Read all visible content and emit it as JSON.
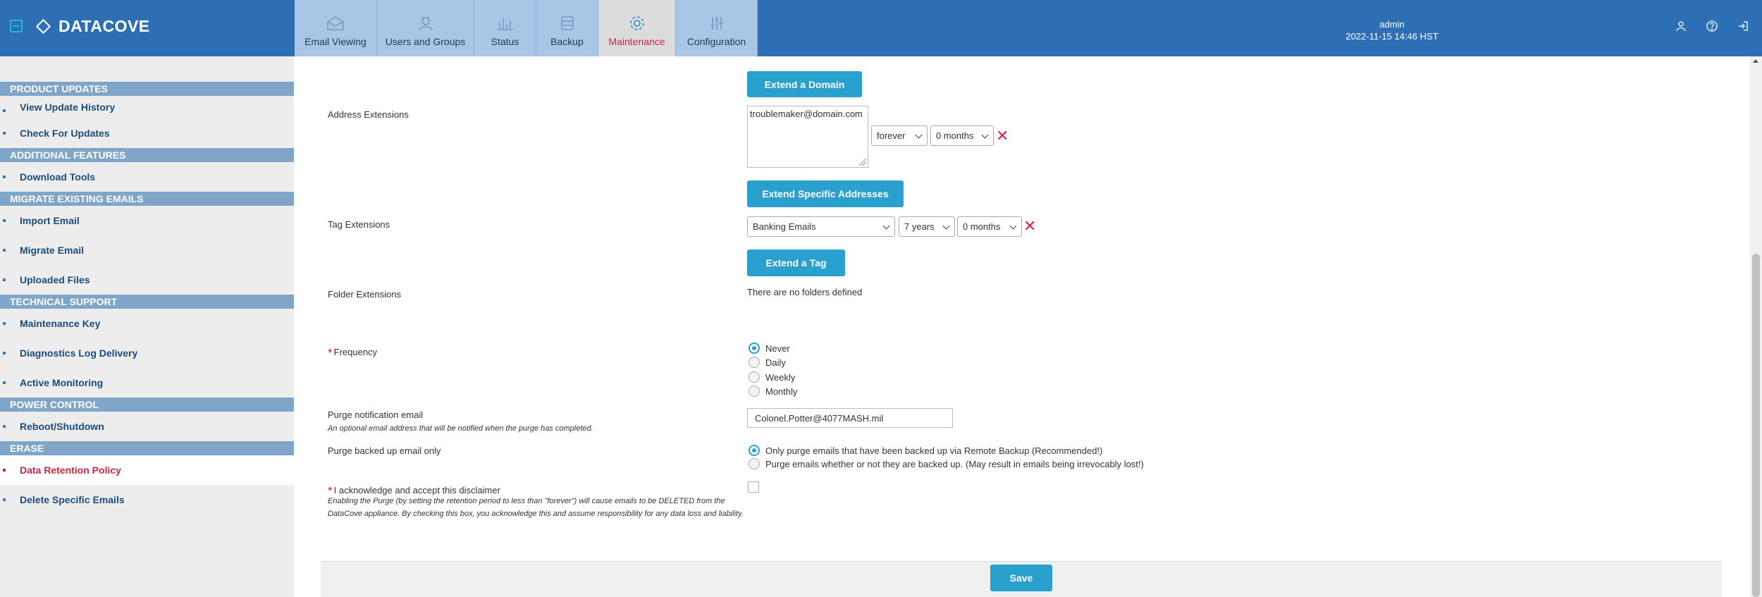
{
  "header": {
    "brand": "DATACOVE",
    "tabs": [
      {
        "label": "Email Viewing",
        "icon": "envelope-icon"
      },
      {
        "label": "Users and Groups",
        "icon": "users-icon"
      },
      {
        "label": "Status",
        "icon": "bar-chart-icon"
      },
      {
        "label": "Backup",
        "icon": "database-icon"
      },
      {
        "label": "Maintenance",
        "icon": "gear-icon",
        "active": true
      },
      {
        "label": "Configuration",
        "icon": "sliders-icon"
      }
    ],
    "user": "admin",
    "datetime": "2022-11-15 14:46 HST"
  },
  "sidebar": {
    "sections": [
      {
        "title": "PRODUCT UPDATES",
        "items": [
          "View Update History",
          "Check For Updates"
        ]
      },
      {
        "title": "ADDITIONAL FEATURES",
        "items": [
          "Download Tools"
        ]
      },
      {
        "title": "MIGRATE EXISTING EMAILS",
        "items": [
          "Import Email",
          "Migrate Email",
          "Uploaded Files"
        ]
      },
      {
        "title": "TECHNICAL SUPPORT",
        "items": [
          "Maintenance Key",
          "Diagnostics Log Delivery",
          "Active Monitoring"
        ]
      },
      {
        "title": "POWER CONTROL",
        "items": [
          "Reboot/Shutdown"
        ]
      },
      {
        "title": "ERASE",
        "items": [
          "Data Retention Policy",
          "Delete Specific Emails"
        ]
      }
    ],
    "active_item": "Data Retention Policy"
  },
  "form": {
    "extend_domain_button": "Extend a Domain",
    "address_extensions": {
      "label": "Address Extensions",
      "textarea_value": "troublemaker@domain.com",
      "years_value": "forever",
      "months_value": "0 months"
    },
    "extend_addresses_button": "Extend Specific Addresses",
    "tag_extensions": {
      "label": "Tag Extensions",
      "tag_value": "Banking Emails",
      "years_value": "7 years",
      "months_value": "0 months"
    },
    "extend_tag_button": "Extend a Tag",
    "folder_extensions": {
      "label": "Folder Extensions",
      "value": "There are no folders defined"
    },
    "frequency": {
      "label": "Frequency",
      "required_mark": "*",
      "options": [
        "Never",
        "Daily",
        "Weekly",
        "Monthly"
      ],
      "selected": "Never"
    },
    "purge_email": {
      "label": "Purge notification email",
      "help": "An optional email address that will be notified when the purge has completed.",
      "value": "Colonel.Potter@4077MASH.mil"
    },
    "purge_backed_up": {
      "label": "Purge backed up email only",
      "options": [
        "Only purge emails that have been backed up via Remote Backup (Recommended!)",
        "Purge emails whether or not they are backed up. (May result in emails being irrevocably lost!)"
      ],
      "selected": 0
    },
    "disclaimer": {
      "label": "I acknowledge and accept this disclaimer",
      "required_mark": "*",
      "text": "Enabling the Purge (by setting the retention period to less than \"forever\") will cause emails to be DELETED from the DataCove appliance. By checking this box, you acknowledge this and assume responsibility for any data loss and liability.",
      "checked": false
    },
    "save_button": "Save"
  },
  "colors": {
    "header_bg": "#2d6fb4",
    "tab_bg": "#a9c6e6",
    "tab_active_bg": "#dcdcdc",
    "accent_red": "#c8283c",
    "button_blue": "#2aa0cf",
    "section_bg": "#7fa5c8"
  }
}
